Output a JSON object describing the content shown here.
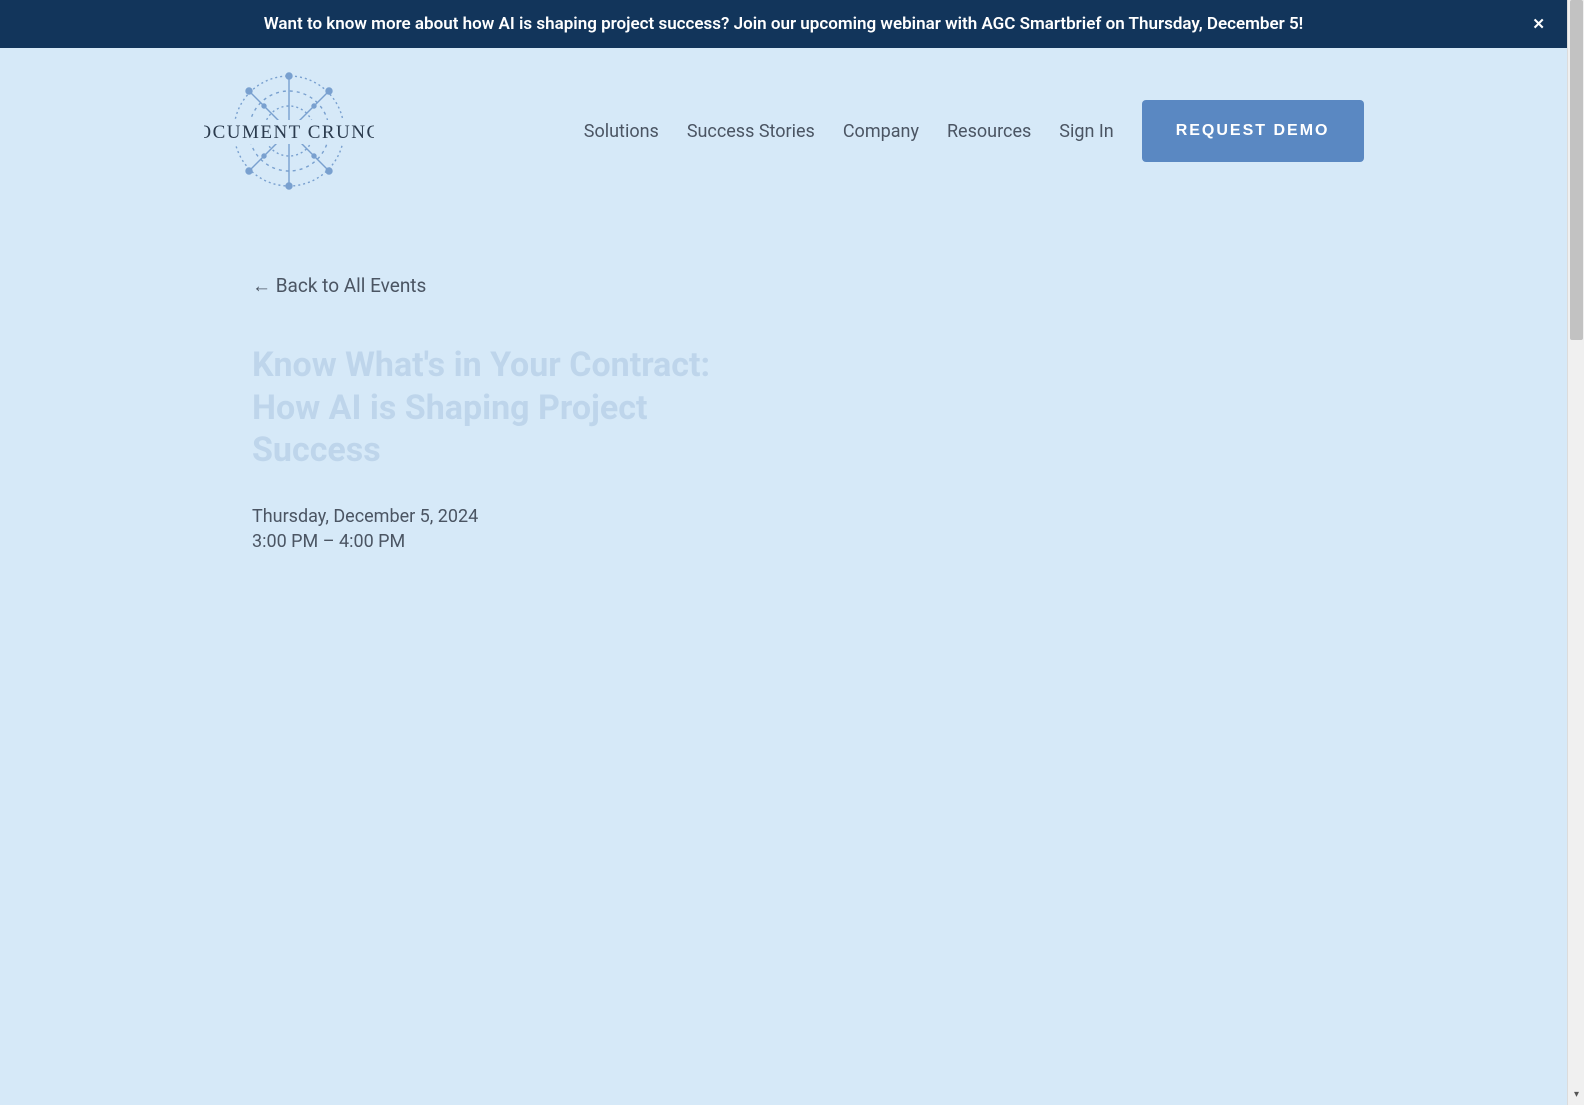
{
  "announcement": {
    "text": "Want to know more about how AI is shaping project success? Join our upcoming webinar with AGC Smartbrief on Thursday, December 5!",
    "close_glyph": "✕"
  },
  "brand": {
    "name": "DOCUMENT CRUNCH"
  },
  "nav": {
    "items": [
      {
        "label": "Solutions"
      },
      {
        "label": "Success Stories"
      },
      {
        "label": "Company"
      },
      {
        "label": "Resources"
      },
      {
        "label": "Sign In"
      }
    ],
    "cta_label": "REQUEST DEMO"
  },
  "main": {
    "back_link": "← Back to All Events",
    "event_title": "Know What's in Your Contract: How AI is Shaping Project Success",
    "event_date": "Thursday, December 5, 2024",
    "event_time": "3:00 PM – 4:00 PM"
  }
}
